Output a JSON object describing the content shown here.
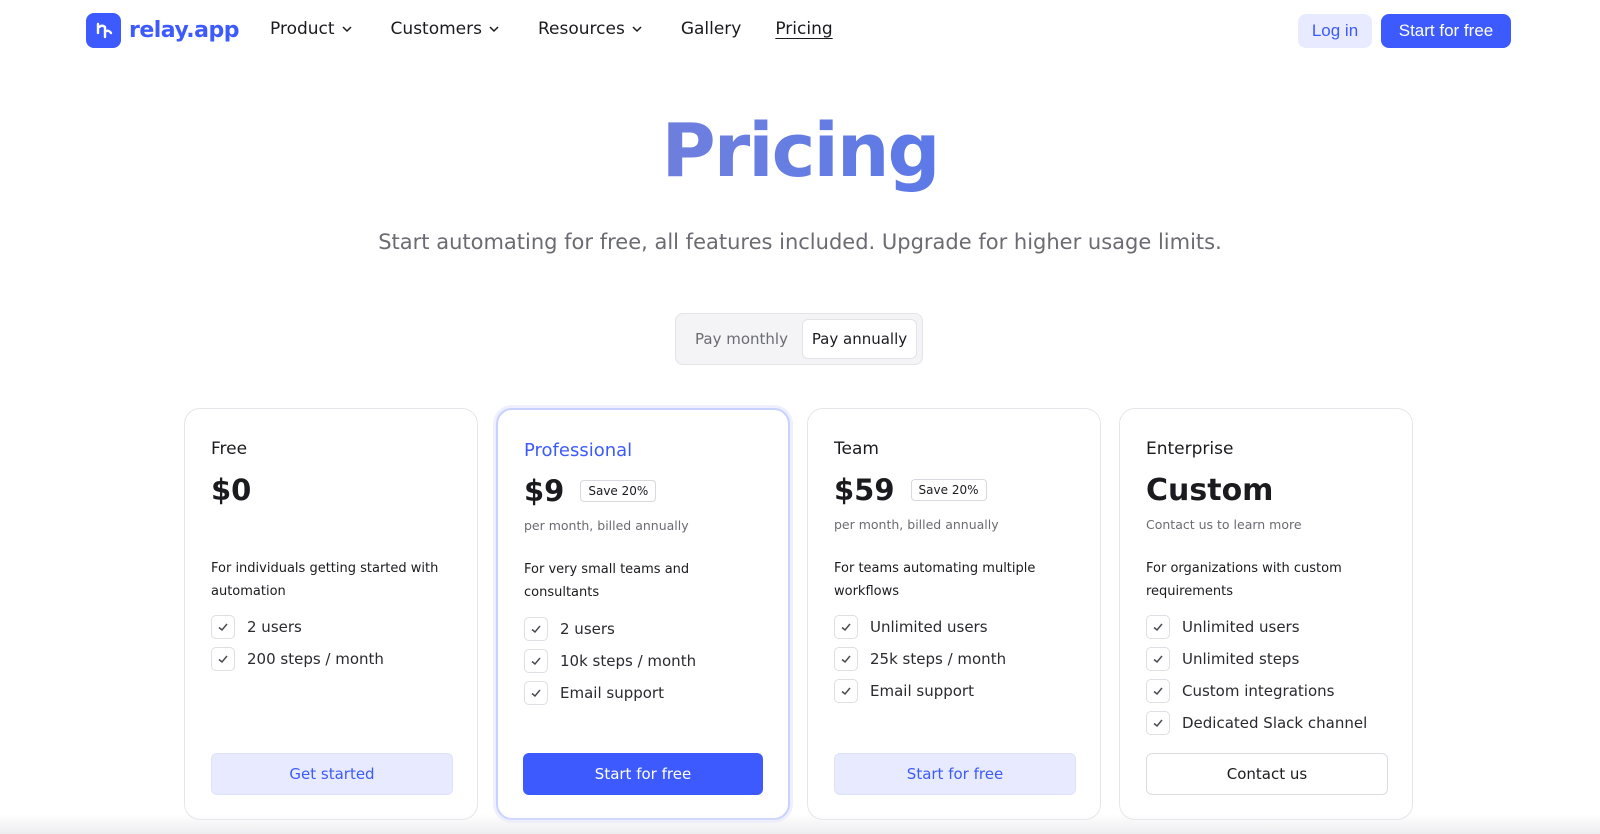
{
  "brand": {
    "name": "relay.app",
    "color": "#3d5afe"
  },
  "nav": {
    "items": [
      {
        "label": "Product",
        "has_dropdown": true
      },
      {
        "label": "Customers",
        "has_dropdown": true
      },
      {
        "label": "Resources",
        "has_dropdown": true
      },
      {
        "label": "Gallery",
        "has_dropdown": false
      },
      {
        "label": "Pricing",
        "has_dropdown": false,
        "active": true
      }
    ],
    "login_label": "Log in",
    "start_label": "Start for free"
  },
  "hero": {
    "title": "Pricing",
    "subtitle": "Start automating for free, all features included. Upgrade for higher usage limits."
  },
  "billing_toggle": {
    "options": [
      "Pay monthly",
      "Pay annually"
    ],
    "selected": "Pay annually"
  },
  "plans": [
    {
      "name": "Free",
      "price": "$0",
      "badge": "",
      "billing_note": "",
      "description": "For individuals getting started with automation",
      "features": [
        "2 users",
        "200 steps / month"
      ],
      "cta": "Get started"
    },
    {
      "name": "Professional",
      "price": "$9",
      "badge": "Save 20%",
      "billing_note": "per month, billed annually",
      "description": "For very small teams and consultants",
      "features": [
        "2 users",
        "10k steps / month",
        "Email support"
      ],
      "cta": "Start for free",
      "highlighted": true
    },
    {
      "name": "Team",
      "price": "$59",
      "badge": "Save 20%",
      "billing_note": "per month, billed annually",
      "description": "For teams automating multiple workflows",
      "features": [
        "Unlimited users",
        "25k steps / month",
        "Email support"
      ],
      "cta": "Start for free"
    },
    {
      "name": "Enterprise",
      "price": "Custom",
      "badge": "",
      "billing_note": "Contact us to learn more",
      "description": "For organizations with custom requirements",
      "features": [
        "Unlimited users",
        "Unlimited steps",
        "Custom integrations",
        "Dedicated Slack channel"
      ],
      "cta": "Contact us"
    }
  ]
}
